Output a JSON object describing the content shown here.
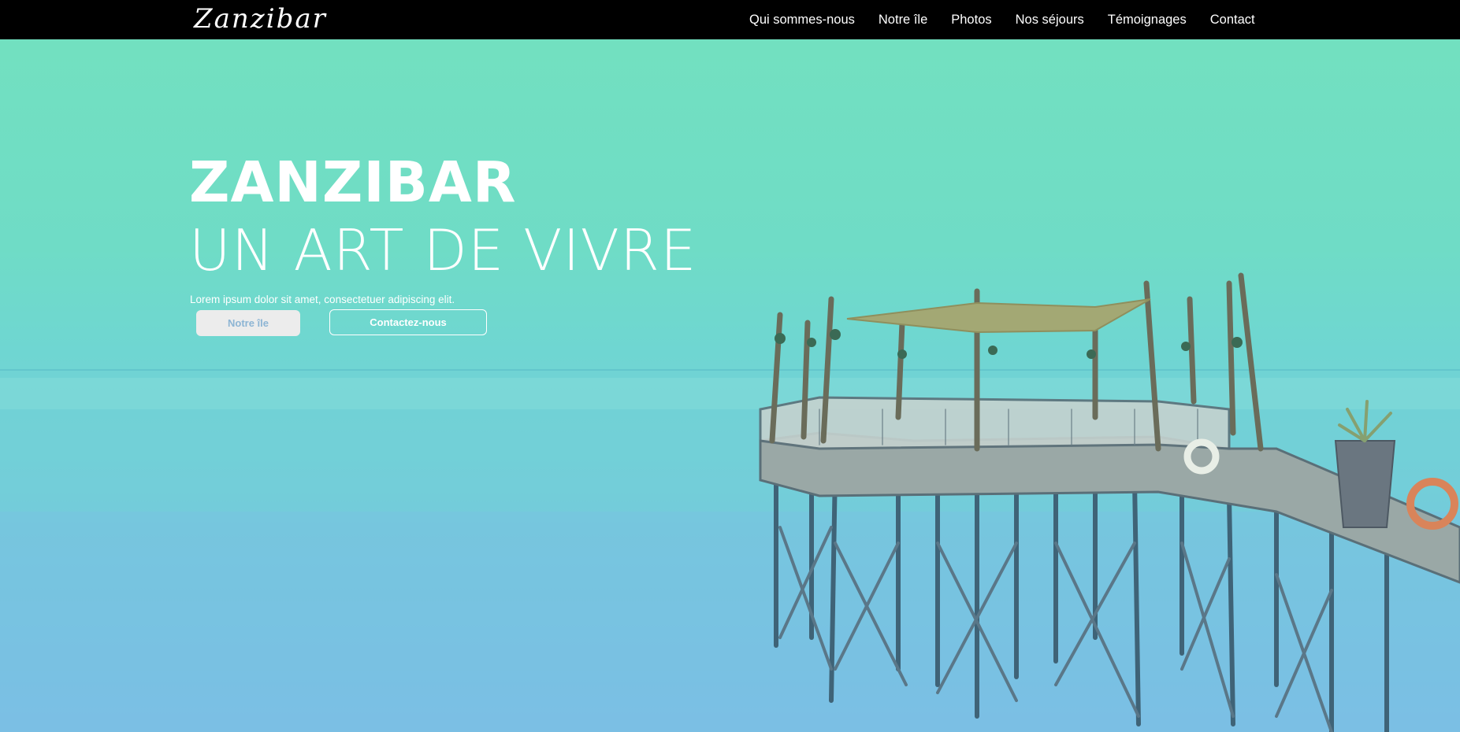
{
  "brand": {
    "logo": "Zanzibar"
  },
  "nav": {
    "items": [
      {
        "label": "Qui sommes-nous"
      },
      {
        "label": "Notre île"
      },
      {
        "label": "Photos"
      },
      {
        "label": "Nos séjours"
      },
      {
        "label": "Témoignages"
      },
      {
        "label": "Contact"
      }
    ]
  },
  "hero": {
    "title": "ZANZIBAR",
    "subtitle": "UN ART DE VIVRE",
    "text": "Lorem ipsum dolor sit amet, consectetuer adipiscing elit.",
    "primary_button": "Notre île",
    "secondary_button": "Contactez-nous"
  },
  "colors": {
    "navbar": "#000000",
    "overlay_top": "#72e0c0",
    "overlay_bottom": "#82b8ec",
    "button_primary_bg": "#ececec",
    "button_primary_text": "#8db5d4"
  }
}
